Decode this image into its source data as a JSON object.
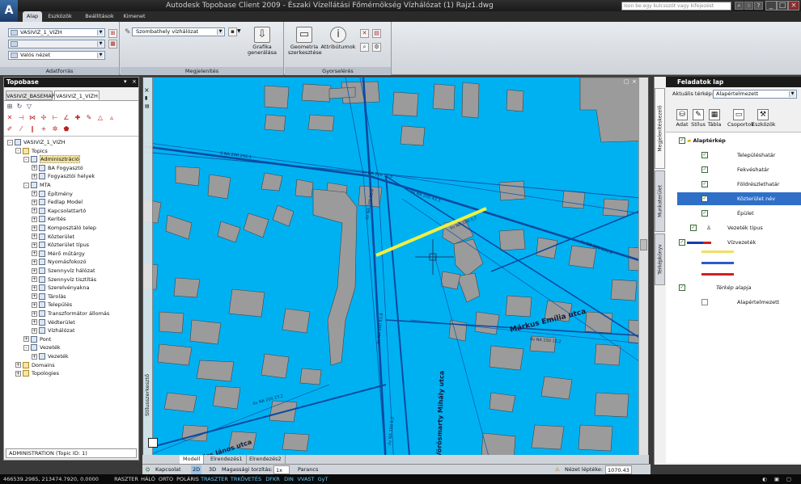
{
  "titlebar": {
    "title": "Autodesk Topobase Client 2009 - Északi Vízellátási Főmérnökség Vízhálózat (1) Rajz1.dwg",
    "search_placeholder": "Ison be egy kulcsszót vagy kifejezést",
    "logo": "A"
  },
  "ribbon_tabs": [
    "Alap",
    "Eszközök",
    "Beállítások",
    "Kimenet"
  ],
  "ribbon": {
    "workspace_combo": "VASIVIZ_1_VIZH",
    "view_combo": "Valós nézet",
    "panel_adatforras": "Adatforrás",
    "display_combo": "Szombathely vízhálózat",
    "btn_grafika": "Grafika generálása",
    "panel_megjelenites": "Megjelenítés",
    "btn_geometria": "Geometria szerkesztése",
    "btn_attributumok": "Attribútumok",
    "panel_gyorselérés": "Gyorselérés"
  },
  "left": {
    "header": "Topobase",
    "tabs": [
      "VASIVIZ_BASEMAP",
      "VASIVIZ_1_VIZH"
    ],
    "tree": [
      {
        "label": "VASIVIZ_1_VIZH",
        "level": 0,
        "exp": "-"
      },
      {
        "label": "Topics",
        "level": 1,
        "exp": "-"
      },
      {
        "label": "Adminisztráció",
        "level": 2,
        "exp": "-",
        "highlight": true
      },
      {
        "label": "BA Fogyasztó",
        "level": 3,
        "exp": "+"
      },
      {
        "label": "Fogyasztói helyek",
        "level": 3,
        "exp": "+"
      },
      {
        "label": "MTA",
        "level": 2,
        "exp": "-"
      },
      {
        "label": "Építmény",
        "level": 3,
        "exp": "+"
      },
      {
        "label": "Fedlap Model",
        "level": 3,
        "exp": "+"
      },
      {
        "label": "Kapcsolattartó",
        "level": 3,
        "exp": "+"
      },
      {
        "label": "Kerítés",
        "level": 3,
        "exp": "+"
      },
      {
        "label": "Komposztáló telep",
        "level": 3,
        "exp": "+"
      },
      {
        "label": "Közterület",
        "level": 3,
        "exp": "+"
      },
      {
        "label": "Közterület típus",
        "level": 3,
        "exp": "+"
      },
      {
        "label": "Mérő műtárgy",
        "level": 3,
        "exp": "+"
      },
      {
        "label": "Nyomásfokozó",
        "level": 3,
        "exp": "+"
      },
      {
        "label": "Szennyvíz hálózat",
        "level": 3,
        "exp": "+"
      },
      {
        "label": "Szennyvíz tisztítás",
        "level": 3,
        "exp": "+"
      },
      {
        "label": "Szerelvényakna",
        "level": 3,
        "exp": "+"
      },
      {
        "label": "Tárolás",
        "level": 3,
        "exp": "+"
      },
      {
        "label": "Település",
        "level": 3,
        "exp": "+"
      },
      {
        "label": "Transzformátor állomás",
        "level": 3,
        "exp": "+"
      },
      {
        "label": "Védterület",
        "level": 3,
        "exp": "+"
      },
      {
        "label": "Vízhálózat",
        "level": 3,
        "exp": "+"
      },
      {
        "label": "Pont",
        "level": 2,
        "exp": "+"
      },
      {
        "label": "Vezeték",
        "level": 2,
        "exp": "-"
      },
      {
        "label": "Vezeték",
        "level": 3,
        "exp": "+"
      },
      {
        "label": "Domains",
        "level": 1,
        "exp": "+"
      },
      {
        "label": "Topologies",
        "level": 1,
        "exp": "+"
      }
    ],
    "status": "ADMINISTRATION (Topic ID: 1)"
  },
  "map": {
    "side_label": "Stílusszerkesztő",
    "streets": [
      "Márkus Emília utca",
      "Vörösmarty Mihály utca",
      "Kiss János utca"
    ],
    "pipe_labels": [
      "ő NA 200 292,1",
      "öv NA 200 17,6",
      "öv NA 200 43,3",
      "öv NA 100 0,7",
      "öv NA 200 131,6",
      "öv NA 200 95,6",
      "öv NA 100 83,9",
      "öv NA 200 23,2",
      "öv NA 150 12,2",
      "öv NA 150 6,2"
    ],
    "tabs": [
      "Modell",
      "Elrendezés1",
      "Elrendezés2"
    ]
  },
  "cmdbar": {
    "kapcsolat": "Kapcsolat",
    "v2d": "2D",
    "v3d": "3D",
    "magassagi": "Magassági torzítás:",
    "torzitas_val": "1x",
    "parancs": "Parancs",
    "nezet_lepteke": "Nézet léptéke:",
    "scale": "1070.43"
  },
  "right": {
    "header": "Feladatok lap",
    "vtabs": [
      "Megjelenítéskezelő",
      "Munkaterület",
      "Térképkönyv"
    ],
    "aktualis_label": "Aktuális térkép:",
    "aktualis_value": "Alapértelmezett",
    "tools": [
      "Adat",
      "Stílus",
      "Tábla",
      "Csoportok",
      "Eszközök"
    ],
    "layers": [
      {
        "label": "Alaptérkép",
        "bold": true
      },
      {
        "label": "Településhatár"
      },
      {
        "label": "Fekvéshatár"
      },
      {
        "label": "Földrészlethatár"
      },
      {
        "label": "Közterület név",
        "selected": true
      },
      {
        "label": "Épület"
      },
      {
        "label": "Vezeték típus"
      },
      {
        "label": "Vízvezeték"
      },
      {
        "label": "Térkép alapja",
        "italic": true
      },
      {
        "label": "Alapértelmezett"
      }
    ]
  },
  "status": {
    "coords": "466539.2985, 213474.7920, 0.0000",
    "buttons": [
      "RASZTER",
      "HÁLÓ",
      "ORTO",
      "POLÁRIS",
      "TRASZTER",
      "TRKÖVETÉS",
      "DFKR",
      "DIN",
      "VVAST",
      "GyT"
    ]
  }
}
